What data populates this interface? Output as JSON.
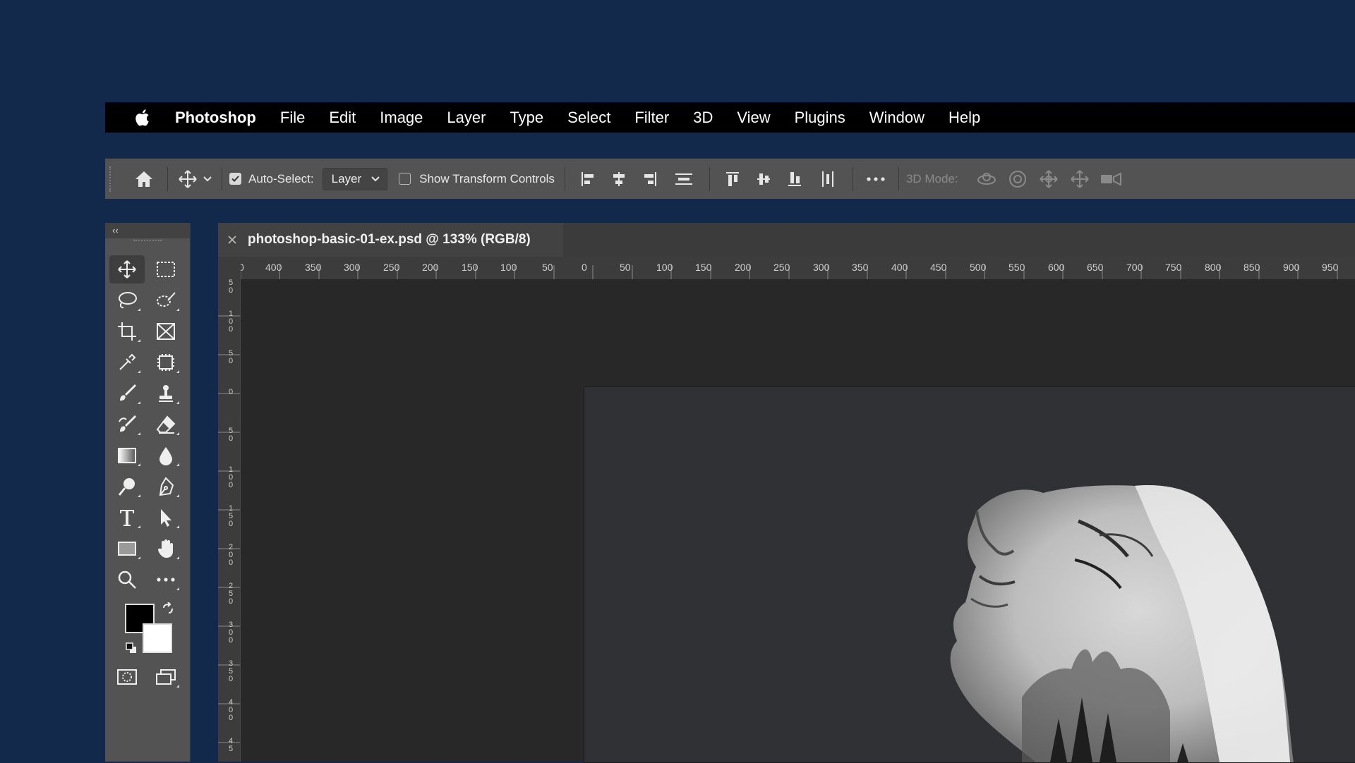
{
  "menubar": {
    "items": [
      "Photoshop",
      "File",
      "Edit",
      "Image",
      "Layer",
      "Type",
      "Select",
      "Filter",
      "3D",
      "View",
      "Plugins",
      "Window",
      "Help"
    ]
  },
  "options": {
    "auto_select_label": "Auto-Select:",
    "auto_select_value": "Layer",
    "show_transform_label": "Show Transform Controls",
    "mode3d_label": "3D Mode:"
  },
  "panel": {
    "collapse_label": "‹‹"
  },
  "document": {
    "tab_title": "photoshop-basic-01-ex.psd @ 133% (RGB/8)",
    "hruler_labels": [
      "0",
      "400",
      "350",
      "300",
      "250",
      "200",
      "150",
      "100",
      "50",
      "0",
      "50",
      "100",
      "150",
      "200",
      "250",
      "300",
      "350",
      "400",
      "450",
      "500",
      "550",
      "600",
      "650",
      "700",
      "750",
      "800",
      "850",
      "900",
      "950"
    ],
    "vruler_labels": [
      "5 0",
      "1 0 0",
      "5 0",
      "0",
      "5 0",
      "1 0 0",
      "1 5 0",
      "2 0 0",
      "2 5 0",
      "3 0 0",
      "3 5 0",
      "4 0 0",
      "4 5"
    ]
  },
  "colors": {
    "accent_bg": "#13294b",
    "panel": "#535353",
    "canvas": "#282828"
  }
}
